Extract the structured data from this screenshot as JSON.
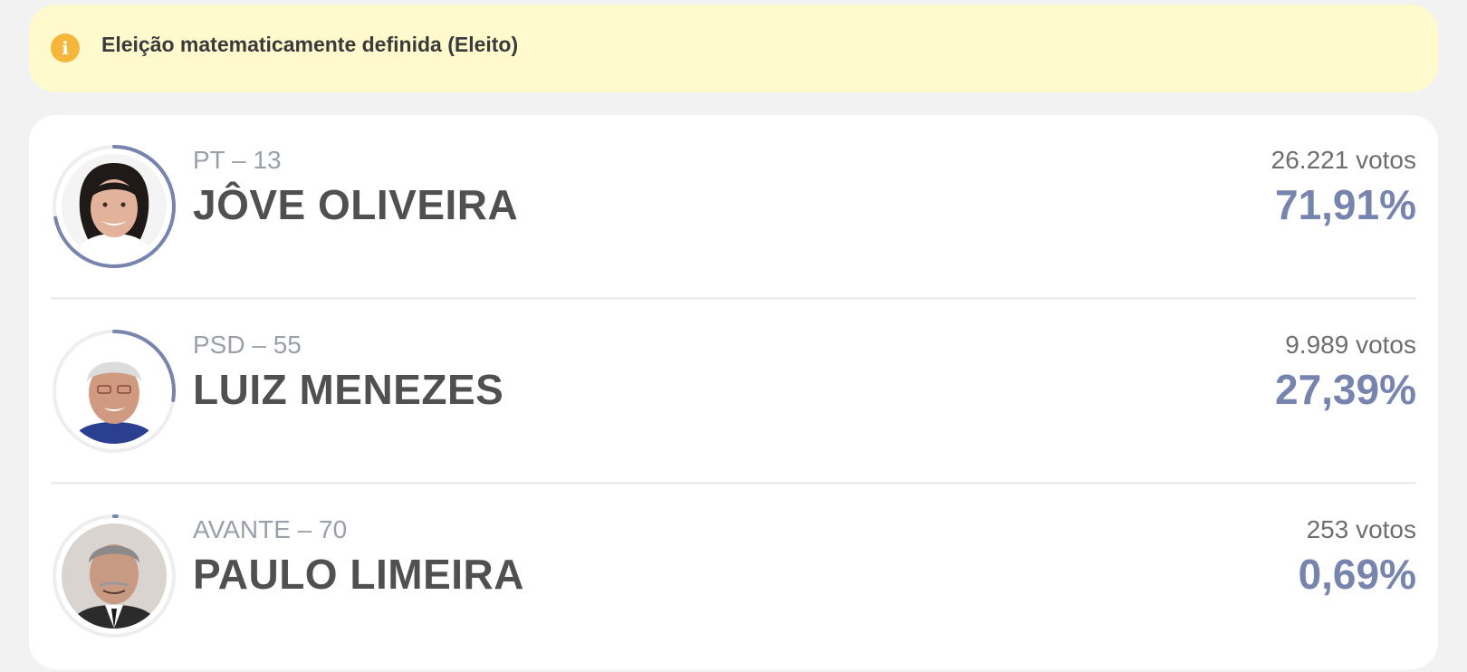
{
  "banner": {
    "icon": "info-icon",
    "text": "Eleição matematicamente definida (Eleito)",
    "background": "#fefacd",
    "icon_color": "#f5b63c"
  },
  "colors": {
    "accent": "#7784ad",
    "ring_track": "#eeeeee",
    "name": "#505050",
    "party": "#9aa0a8"
  },
  "candidates": [
    {
      "party": "PT – 13",
      "name": "JÔVE OLIVEIRA",
      "votes": "26.221 votos",
      "percent": "71,91%",
      "share": 0.7191
    },
    {
      "party": "PSD – 55",
      "name": "LUIZ MENEZES",
      "votes": "9.989 votos",
      "percent": "27,39%",
      "share": 0.2739
    },
    {
      "party": "AVANTE – 70",
      "name": "PAULO LIMEIRA",
      "votes": "253 votos",
      "percent": "0,69%",
      "share": 0.0069
    }
  ]
}
